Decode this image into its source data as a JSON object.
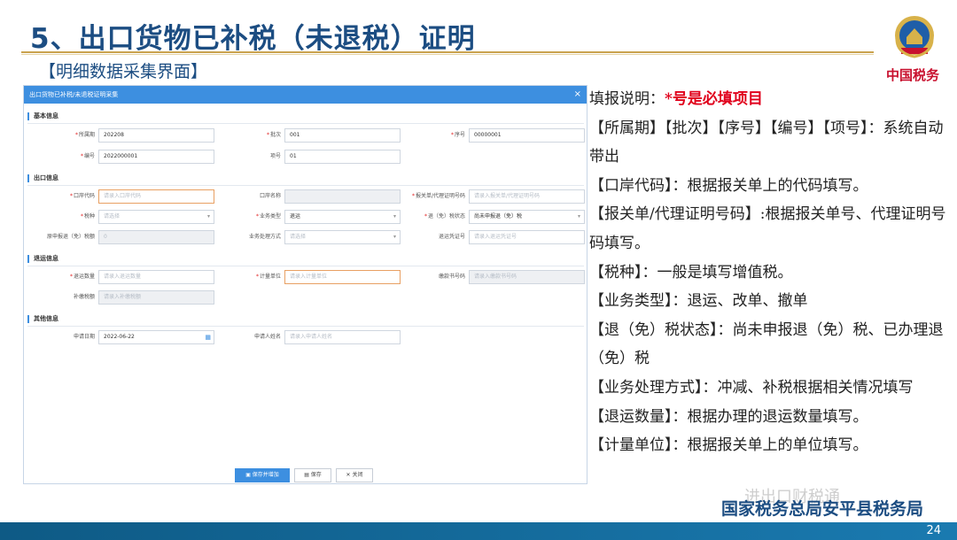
{
  "slide": {
    "title": "5、出口货物已补税（未退税）证明",
    "section_tag": "【明细数据采集界面】",
    "emblem_caption": "中国税务",
    "bureau": "国家税务总局安平县税务局",
    "watermark": "进出口财税通",
    "page_number": "24"
  },
  "window": {
    "title": "出口货物已补税/未退税证明采集",
    "close_glyph": "×",
    "sections": {
      "basic": "基本信息",
      "export": "出口信息",
      "return": "退运信息",
      "other": "其他信息"
    },
    "fields": {
      "period": {
        "label": "所属期",
        "value": "202208"
      },
      "batch": {
        "label": "批次",
        "value": "001"
      },
      "serial": {
        "label": "序号",
        "value": "00000001"
      },
      "number": {
        "label": "编号",
        "value": "2022000001"
      },
      "item_no": {
        "label": "项号",
        "value": "01"
      },
      "port_code": {
        "label": "口岸代码",
        "placeholder": "请录入口岸代码"
      },
      "port_name": {
        "label": "口岸名称",
        "value": ""
      },
      "declaration_no": {
        "label": "报关单/代理证明号码",
        "placeholder": "请录入报关单/代理证明号码"
      },
      "tax_type": {
        "label": "税种",
        "placeholder": "请选择"
      },
      "business_type": {
        "label": "业务类型",
        "value": "退运"
      },
      "refund_status": {
        "label": "退（免）税状态",
        "value": "尚未申报退（免）税"
      },
      "original_amount": {
        "label": "原申报退（免）税额",
        "value": "0"
      },
      "handling_method": {
        "label": "业务处理方式",
        "placeholder": "请选择"
      },
      "return_cert_no": {
        "label": "退运凭证号",
        "placeholder": "请录入退运凭证号"
      },
      "return_qty": {
        "label": "退运数量",
        "placeholder": "请录入退运数量"
      },
      "unit": {
        "label": "计量单位",
        "placeholder": "请录入计量单位"
      },
      "invoice_no": {
        "label": "缴款书号码",
        "placeholder": "请录入缴款书号码"
      },
      "supplement_amount": {
        "label": "补缴税额",
        "placeholder": "请录入补缴税额"
      },
      "apply_date": {
        "label": "申请日期",
        "value": "2022-06-22"
      },
      "applicant": {
        "label": "申请人姓名",
        "placeholder": "请录入申请人姓名"
      }
    },
    "buttons": {
      "save_add": "保存并增加",
      "save": "保存",
      "close": "关闭"
    }
  },
  "notes": {
    "intro_label": "填报说明：",
    "intro_highlight": "*号是必填项目",
    "items": [
      "【所属期】【批次】【序号】【编号】【项号】：系统自动带出",
      "【口岸代码】：根据报关单上的代码填写。",
      "【报关单/代理证明号码】:根据报关单号、代理证明号码填写。",
      "【税种】：一般是填写增值税。",
      "【业务类型】：退运、改单、撤单",
      "【退（免）税状态】：尚未申报退（免）税、已办理退（免）税",
      "【业务处理方式】：冲减、补税根据相关情况填写",
      "【退运数量】：根据办理的退运数量填写。",
      "【计量单位】：根据报关单上的单位填写。"
    ]
  },
  "colors": {
    "title": "#1c4d82",
    "accent_blue": "#3d8fe0",
    "required_red": "#e0001b",
    "footer": "#0e5a85"
  }
}
